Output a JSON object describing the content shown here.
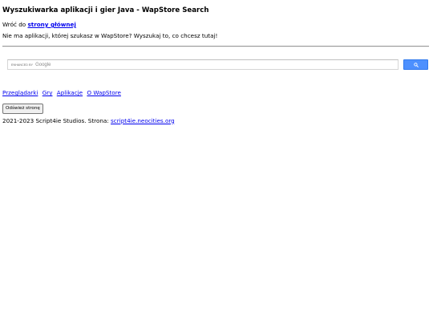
{
  "header": {
    "title": "Wyszukiwarka aplikacji i gier Java - WapStore Search"
  },
  "back": {
    "prefix": "Wróć do",
    "link_label": "strony głównej"
  },
  "info": {
    "text": "Nie ma aplikacji, której szukasz w WapStore? Wyszukaj to, co chcesz tutaj!"
  },
  "search": {
    "enhanced_label": "ENHANCED BY",
    "brand": "Google",
    "button_icon": "search-icon",
    "button_color": "#4d90fe"
  },
  "nav": {
    "items": [
      {
        "label": "Przeglądarki"
      },
      {
        "label": "Gry"
      },
      {
        "label": "Aplikacje"
      },
      {
        "label": "O WapStore"
      }
    ]
  },
  "refresh": {
    "label": "Odśwież stronę"
  },
  "footer": {
    "text": "2021-2023 Script4ie Studios. Strona:",
    "link_label": "script4ie.neocities.org"
  },
  "colors": {
    "link": "#0000ee",
    "accent": "#4d90fe"
  }
}
